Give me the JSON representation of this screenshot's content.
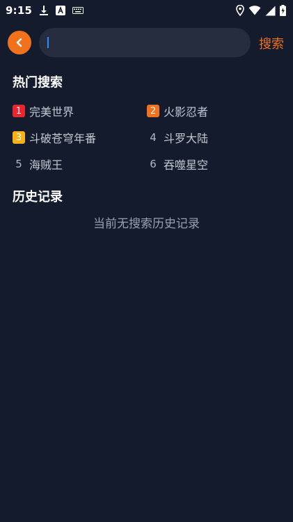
{
  "status_bar": {
    "time": "9:15",
    "icons_left": [
      "download-icon",
      "font-icon",
      "keyboard-icon"
    ],
    "icons_right": [
      "location-icon",
      "wifi-icon",
      "signal-icon",
      "battery-icon"
    ]
  },
  "header": {
    "back_icon": "chevron-left-icon",
    "search_value": "",
    "search_button_label": "搜索"
  },
  "hot_search": {
    "title": "热门搜索",
    "items": [
      {
        "rank": "1",
        "label": "完美世界",
        "badge_color": "#e8262f"
      },
      {
        "rank": "2",
        "label": "火影忍者",
        "badge_color": "#f2711c"
      },
      {
        "rank": "3",
        "label": "斗破苍穹年番",
        "badge_color": "#f5b21a"
      },
      {
        "rank": "4",
        "label": "斗罗大陆",
        "badge_color": null
      },
      {
        "rank": "5",
        "label": "海贼王",
        "badge_color": null
      },
      {
        "rank": "6",
        "label": "吞噬星空",
        "badge_color": null
      }
    ]
  },
  "history": {
    "title": "历史记录",
    "empty_text": "当前无搜索历史记录"
  },
  "colors": {
    "background": "#141b2d",
    "accent": "#f2711c",
    "search_box": "#252d3f"
  }
}
